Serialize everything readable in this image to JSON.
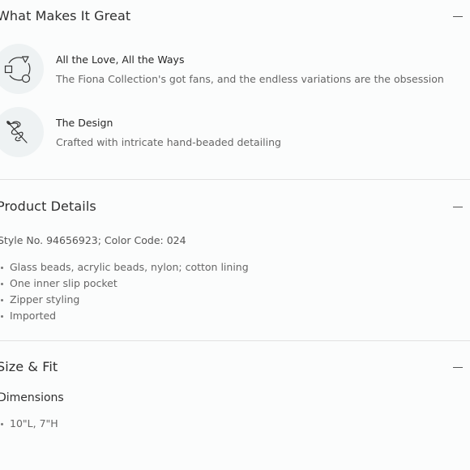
{
  "what_makes_it_great": {
    "title": "What Makes It Great",
    "toggle_icon": "minus-icon",
    "features": [
      {
        "icon": "cycle-shapes-icon",
        "title": "All the Love, All the Ways",
        "description": "The Fiona Collection's got fans, and the endless variations are the obsession"
      },
      {
        "icon": "needle-thread-icon",
        "title": "The Design",
        "description": "Crafted with intricate hand-beaded detailing"
      }
    ]
  },
  "product_details": {
    "title": "Product Details",
    "toggle_icon": "minus-icon",
    "style_line": "Style No. 94656923; Color Code: 024",
    "bullets": [
      "Glass beads, acrylic beads, nylon; cotton lining",
      "One inner slip pocket",
      "Zipper styling",
      "Imported"
    ]
  },
  "size_fit": {
    "title": "Size & Fit",
    "toggle_icon": "minus-icon",
    "dimensions_heading": "Dimensions",
    "bullets": [
      "10\"L, 7\"H"
    ]
  },
  "colors": {
    "background": "#fbfcfc",
    "icon_circle": "#eef2f3",
    "divider": "#e1e1e1"
  }
}
